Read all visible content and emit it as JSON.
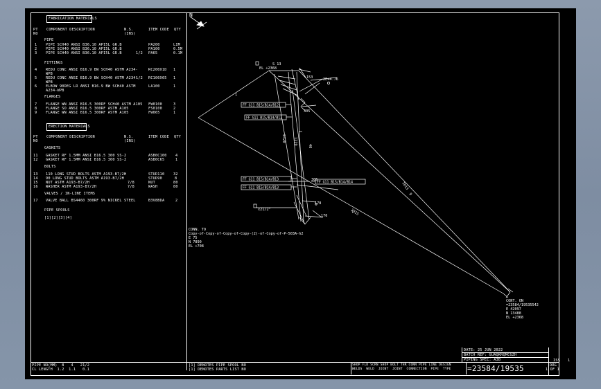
{
  "colors": {
    "background": "#000000",
    "linework": "#ffffff",
    "frame": "#8c9aad"
  },
  "fabrication": {
    "title": "FABRICATION MATERIALS",
    "col_pt": "PT NO",
    "col_desc": "COMPONENT DESCRIPTION",
    "col_ns": "N.S. (INS)",
    "col_item": "ITEM CODE",
    "col_qty": "QTY",
    "sections": [
      {
        "name": "PIPE",
        "rows": [
          {
            "pt": "1",
            "desc": "PIPE SCH40 ANSI B36.10 API5L GR.B",
            "ns": "",
            "item": "PA200",
            "qty": "LIM"
          },
          {
            "pt": "2",
            "desc": "PIPE SCH40 ANSI B36.10 API5L GR.B",
            "ns": "",
            "item": "PA100",
            "qty": "0.5M"
          },
          {
            "pt": "3",
            "desc": "PIPE SCH40 ANSI B36.10 API5L GR.B",
            "ns": "1/2",
            "item": "PA65",
            "qty": "0.1M"
          }
        ]
      },
      {
        "name": "FITTINGS",
        "rows": [
          {
            "pt": "4",
            "desc": "REDU CONC ANSI B16.9 BW SCH40 ASTM A234-WPB",
            "ns": "",
            "item": "RC200X1D",
            "qty": "1"
          },
          {
            "pt": "5",
            "desc": "REDU CONC ANSI B16.9 BW SCH40 ASTM A234-WPB",
            "ns": "1/2",
            "item": "RC100X65",
            "qty": "1"
          },
          {
            "pt": "6",
            "desc": "ELBOW 90DEG LR ANSI B16.9 BW SCH40 ASTM A234-WPB",
            "ns": "",
            "item": "LA100",
            "qty": "1"
          }
        ]
      },
      {
        "name": "FLANGES",
        "rows": [
          {
            "pt": "7",
            "desc": "FLANGE WN ANSI B16.5 300RF SCH40 ASTM A105",
            "ns": "",
            "item": "FW0100",
            "qty": "3"
          },
          {
            "pt": "8",
            "desc": "FLANGE SO ANSI B16.5 300RF ASTM A105",
            "ns": "",
            "item": "FS0100",
            "qty": "2"
          },
          {
            "pt": "9",
            "desc": "FLANGE WN ANSI B16.5 300RF ASTM A105",
            "ns": "",
            "item": "FW065",
            "qty": "1"
          }
        ]
      }
    ]
  },
  "erection": {
    "title": "ERECTION MATERIALS",
    "col_pt": "PT NO",
    "col_desc": "COMPONENT DESCRIPTION",
    "col_ns": "N.S. (INS)",
    "col_item": "ITEM CODE",
    "col_qty": "QTY",
    "sections": [
      {
        "name": "GASKETS",
        "rows": [
          {
            "pt": "11",
            "desc": "GASKET RF 1.5MM ANSI B16.5 300 SS-2",
            "ns": "",
            "item": "ASB0C100",
            "qty": "4"
          },
          {
            "pt": "12",
            "desc": "GASKET RF 1.5MM ANSI B16.5 300 SS-2",
            "ns": "",
            "item": "ASB0C65",
            "qty": "1"
          }
        ]
      },
      {
        "name": "BOLTS",
        "rows": [
          {
            "pt": "13",
            "desc": "110 LONG STUD BOLTS ASTM A193-B7/2H",
            "ns": "",
            "item": "STUD110",
            "qty": "32"
          },
          {
            "pt": "14",
            "desc": "90 LONG STUD BOLTS ASTM A193-B7/2H",
            "ns": "",
            "item": "STUD90",
            "qty": "8"
          },
          {
            "pt": "15",
            "desc": "NUT ASTM A193-B7/2H",
            "ns": "7/8",
            "item": "NUT",
            "qty": "80"
          },
          {
            "pt": "16",
            "desc": "WASHER ASTM A193-B7/2H",
            "ns": "7/8",
            "item": "WASH",
            "qty": "80"
          }
        ]
      },
      {
        "name": "VALVES / IN-LINE ITEMS",
        "rows": [
          {
            "pt": "17",
            "desc": "VALVE BALL BS4460 300RF 9% NICKEL STEEL",
            "ns": "",
            "item": "B3V8BDA",
            "qty": "2"
          }
        ]
      }
    ],
    "spools_title": "PIPE SPOOLS",
    "spools": [
      "1",
      "2",
      "3",
      "4"
    ]
  },
  "footer_left": {
    "row1": "PIPE NO(MM)  8   4   21/2",
    "row2": "CL LENGTH  1.2  1.1   0.1"
  },
  "footer_notes": {
    "note1": "[1] DENOTES PIPE SPOOL NO",
    "note2": "[1] DENOTES PARTS LIST NO"
  },
  "footer_right": {
    "date": "DATE: 25 JUN 2022",
    "batch": "BATCH REF: GUAQKRQMCGZH",
    "spec": "PIPING SPEC: A3B",
    "table_cols": [
      "SHOP FLD",
      "SCRN",
      "SHOP BOLT",
      "THR",
      "CONN",
      "PIPE",
      "LINE DESIGN"
    ],
    "table_row": "WELDS  WELD  JOINT  JOINT  CONNECTION  PIPE  TYPE",
    "drawing_no": "=23584/19535",
    "drg_label": "DRG",
    "drg_value": "1 OF 1",
    "iss_label": "ISS",
    "iss_value": "1"
  },
  "iso": {
    "north": "N",
    "top_el": "EL +2368",
    "top_coords": "S 13",
    "label_153": "153",
    "label_2e": "2E+4.76",
    "label_305a": "305",
    "label_305b": "305",
    "label_178": "178",
    "label_176": "176",
    "label_1": "1",
    "label_7": "7",
    "label_1013": "1013",
    "label_9": "9",
    "label_1315": "1315",
    "label_v1": "2420",
    "label_v2": "1219",
    "label_v3": "40",
    "flag1": "FF G11 B15/B14/B12",
    "flag2": "FF G11 B15/B14/B12",
    "flag3": "FF G11 B15/B14/B13",
    "flag4": "FF G11 B15/B14/B13",
    "flag5": "FF G11 B15/B14/B14",
    "flag_21": "x21/2\"",
    "conn_to_title": "CONN. TO",
    "conn_to_text": "Copy-of-Copy-of-Copy-of-Copy-(2)-of-Copy-of-P-503A-h2",
    "conn_to_e": "E 75",
    "conn_to_n": "N 7890",
    "conn_to_el": "EL +708",
    "cont_on_title": "CONT. ON",
    "cont_on_ref": "=23584/19535542",
    "cont_on_e": "E 42097",
    "cont_on_n": "N 13488",
    "cont_on_el": "EL +2368"
  }
}
